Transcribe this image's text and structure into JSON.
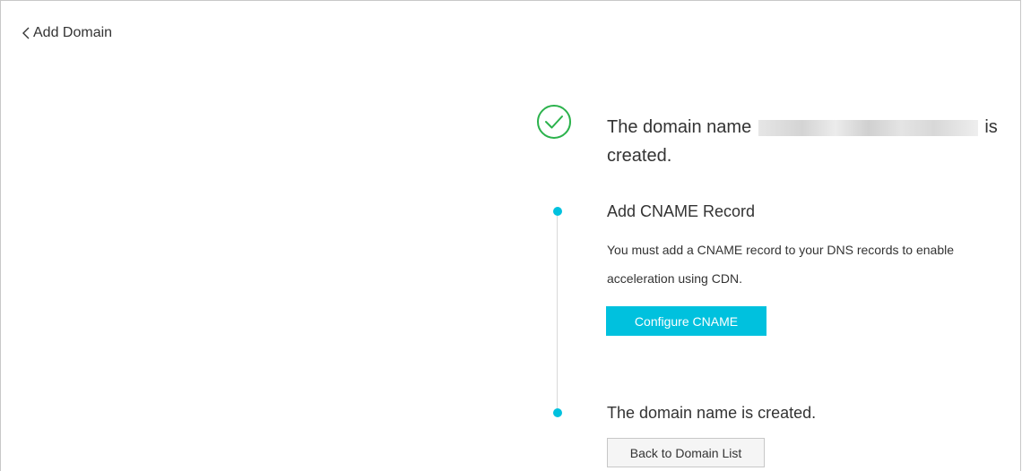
{
  "header": {
    "back_icon": "chevron-left-icon",
    "title": "Add Domain"
  },
  "result": {
    "icon": "check-circle-icon",
    "icon_color": "#2bb24c",
    "headline_prefix": "The domain name",
    "headline_suffix": "is created."
  },
  "steps": [
    {
      "title": "Add CNAME Record",
      "description": "You must add a CNAME record to your DNS records to enable acceleration using CDN.",
      "button_label": "Configure CNAME"
    },
    {
      "title": "The domain name is created.",
      "button_label": "Back to Domain List"
    }
  ],
  "colors": {
    "accent": "#00c1de",
    "success": "#2bb24c",
    "text": "#333333"
  }
}
